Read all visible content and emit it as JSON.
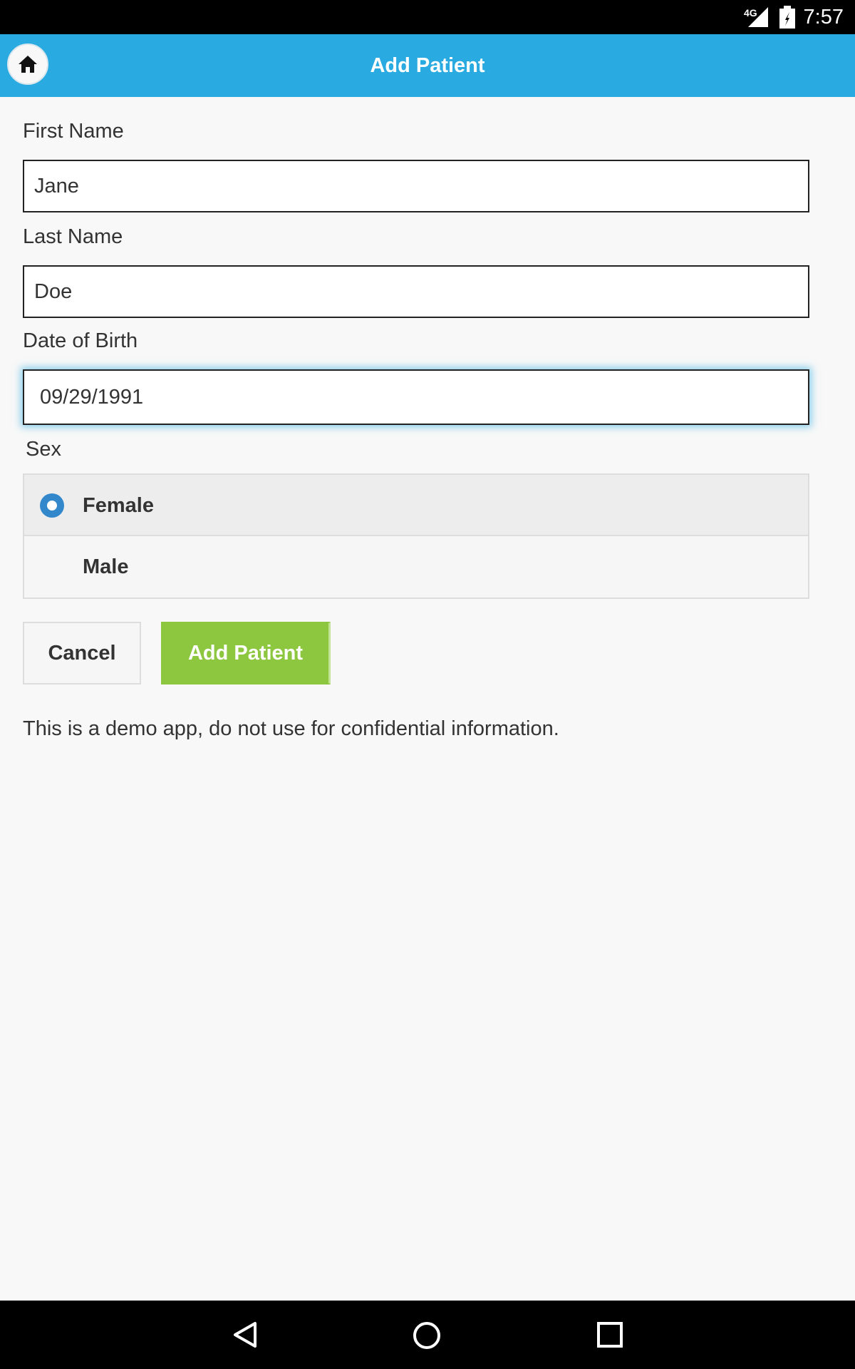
{
  "status_bar": {
    "network": "4G",
    "time": "7:57"
  },
  "header": {
    "title": "Add Patient",
    "home_icon": "home-icon"
  },
  "form": {
    "first_name": {
      "label": "First Name",
      "value": "Jane"
    },
    "last_name": {
      "label": "Last Name",
      "value": "Doe"
    },
    "dob": {
      "label": "Date of Birth",
      "value": "09/29/1991"
    },
    "sex": {
      "label": "Sex",
      "options": [
        {
          "label": "Female",
          "selected": true
        },
        {
          "label": "Male",
          "selected": false
        }
      ]
    },
    "cancel_label": "Cancel",
    "submit_label": "Add Patient",
    "disclaimer": "This is a demo app, do not use for confidential information."
  },
  "colors": {
    "header_bg": "#29abe2",
    "submit_bg": "#8dc63f",
    "radio_accent": "#3388cc"
  },
  "nav_bar": {
    "icons": [
      "back-icon",
      "home-circle-icon",
      "recents-icon"
    ]
  }
}
